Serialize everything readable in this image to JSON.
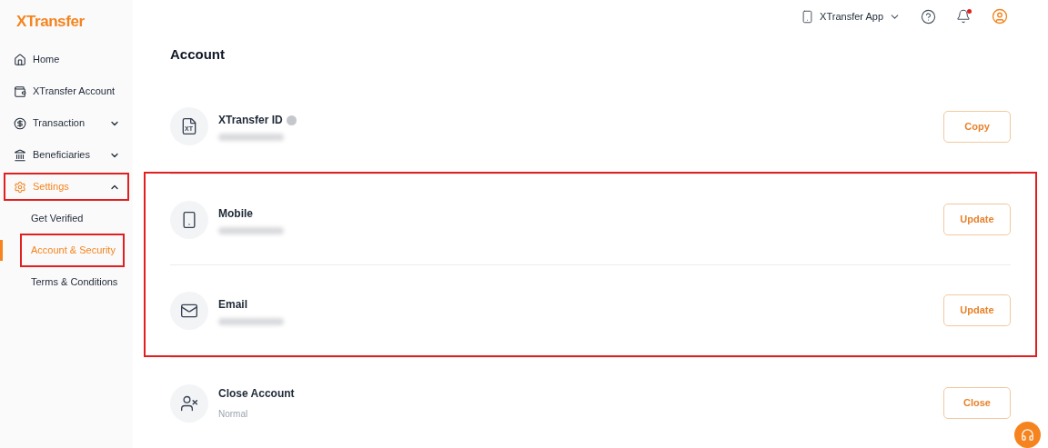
{
  "logo": "XTransfer",
  "sidebar": {
    "items": [
      {
        "kind": "link",
        "label": "Home",
        "selected": false,
        "highlighted": false
      },
      {
        "kind": "link",
        "label": "XTransfer Account",
        "selected": false,
        "highlighted": false
      },
      {
        "kind": "group",
        "label": "Transaction",
        "selected": false,
        "expanded": false,
        "highlighted": false
      },
      {
        "kind": "group",
        "label": "Beneficiaries",
        "selected": false,
        "expanded": false,
        "highlighted": false
      },
      {
        "kind": "group",
        "label": "Settings",
        "selected": true,
        "expanded": true,
        "highlighted": true,
        "children": [
          {
            "label": "Get Verified",
            "selected": false,
            "highlighted": false
          },
          {
            "label": "Account & Security",
            "selected": true,
            "highlighted": true
          },
          {
            "label": "Terms & Conditions",
            "selected": false,
            "highlighted": false
          }
        ]
      }
    ]
  },
  "header": {
    "app_link": "XTransfer App",
    "notification_unread": true
  },
  "page_title": "Account",
  "sections": [
    {
      "highlighted": false,
      "rows": [
        {
          "icon_label": "XT",
          "title": "XTransfer ID",
          "help": true,
          "value_hidden": true,
          "button": "Copy"
        }
      ]
    },
    {
      "highlighted": true,
      "rows": [
        {
          "title": "Mobile",
          "help": false,
          "value_hidden": true,
          "button": "Update"
        },
        {
          "title": "Email",
          "help": false,
          "value_hidden": true,
          "button": "Update"
        }
      ]
    },
    {
      "highlighted": false,
      "rows": [
        {
          "title": "Close Account",
          "help": false,
          "value_hidden": false,
          "value": "Normal",
          "button": "Close"
        }
      ]
    }
  ]
}
